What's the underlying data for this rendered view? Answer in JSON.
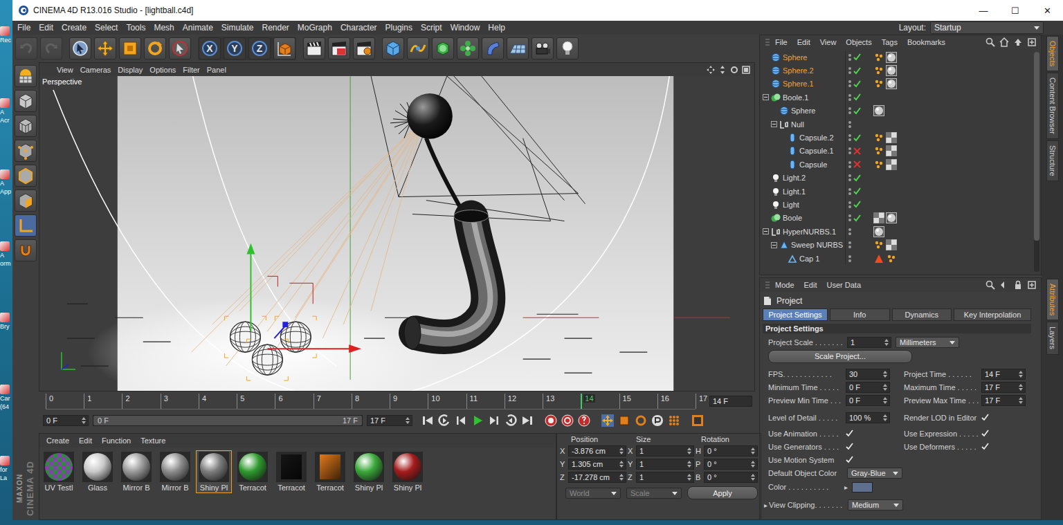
{
  "window": {
    "title": "CINEMA 4D R13.016 Studio - [lightball.c4d]",
    "controls": [
      "—",
      "☐",
      "✕"
    ]
  },
  "desktop_edge": [
    {
      "lines": [
        "Rec"
      ]
    },
    {
      "lines": [
        "A",
        "Acr"
      ]
    },
    {
      "lines": [
        "A",
        "App"
      ]
    },
    {
      "lines": [
        "A",
        "orm"
      ]
    },
    {
      "lines": [
        "Bry"
      ]
    },
    {
      "lines": [
        "Car",
        "(64"
      ]
    },
    {
      "lines": [
        "for",
        "La"
      ]
    }
  ],
  "menu": [
    "File",
    "Edit",
    "Create",
    "Select",
    "Tools",
    "Mesh",
    "Animate",
    "Simulate",
    "Render",
    "MoGraph",
    "Character",
    "Plugins",
    "Script",
    "Window",
    "Help"
  ],
  "layout": {
    "label": "Layout:",
    "value": "Startup"
  },
  "toolbar": {
    "axes": [
      {
        "label": "X",
        "on": true
      },
      {
        "label": "Y",
        "on": true
      },
      {
        "label": "Z",
        "on": true
      }
    ]
  },
  "logo": {
    "brand": "MAXON",
    "product": "CINEMA 4D"
  },
  "viewport": {
    "menu": [
      "View",
      "Cameras",
      "Display",
      "Options",
      "Filter",
      "Panel"
    ],
    "camera": "Perspective"
  },
  "timeline": {
    "ticks": [
      "0",
      "1",
      "2",
      "3",
      "4",
      "5",
      "6",
      "7",
      "8",
      "9",
      "10",
      "11",
      "12",
      "13",
      "14",
      "15",
      "16",
      "17"
    ],
    "current": "14",
    "frame": "14 F"
  },
  "transport": {
    "start": "0 F",
    "slider_left": "0 F",
    "slider_right": "17 F",
    "slider_level": 1,
    "end": "17 F"
  },
  "materials": {
    "menu": [
      "Create",
      "Edit",
      "Function",
      "Texture"
    ],
    "items": [
      {
        "name": "UV Testl",
        "kind": "checker",
        "color": "#8a3fb0",
        "selected": false
      },
      {
        "name": "Glass",
        "kind": "sphere",
        "color": "#c9c9c9",
        "selected": false
      },
      {
        "name": "Mirror B",
        "kind": "sphere",
        "color": "#9a9a9a",
        "selected": false
      },
      {
        "name": "Mirror B",
        "kind": "sphere",
        "color": "#8c8c8c",
        "selected": false
      },
      {
        "name": "Shiny Pl",
        "kind": "sphere",
        "color": "#7d7d7d",
        "selected": true
      },
      {
        "name": "Terracot",
        "kind": "sphere",
        "color": "#2f9a2f",
        "selected": false
      },
      {
        "name": "Terracot",
        "kind": "cube",
        "color": "#151515",
        "selected": false
      },
      {
        "name": "Terracot",
        "kind": "cube",
        "color": "#e07a1c",
        "selected": false
      },
      {
        "name": "Shiny Pl",
        "kind": "sphere",
        "color": "#3aa83a",
        "selected": false
      },
      {
        "name": "Shiny Pl",
        "kind": "sphere",
        "color": "#a51c1c",
        "selected": false
      }
    ]
  },
  "coords": {
    "headers": [
      "Position",
      "Size",
      "Rotation"
    ],
    "rows": [
      {
        "axis": "X",
        "position": "-3.876 cm",
        "size_axis": "X",
        "size": "1",
        "rot_axis": "H",
        "rotation": "0 °"
      },
      {
        "axis": "Y",
        "position": "1.305 cm",
        "size_axis": "Y",
        "size": "1",
        "rot_axis": "P",
        "rotation": "0 °"
      },
      {
        "axis": "Z",
        "position": "-17.278 cm",
        "size_axis": "Z",
        "size": "1",
        "rot_axis": "B",
        "rotation": "0 °"
      }
    ],
    "mode": {
      "value": "World",
      "disabled": true
    },
    "size_mode": {
      "value": "Scale",
      "disabled": true
    },
    "apply": "Apply"
  },
  "objects": {
    "menu": [
      "File",
      "Edit",
      "View",
      "Objects",
      "Tags",
      "Bookmarks"
    ],
    "rows": [
      {
        "name": "Sphere",
        "kind": "sphere",
        "depth": 0,
        "has_children": false,
        "expanded": false,
        "selected": true,
        "activation": "on",
        "tags": [
          "phong",
          "material"
        ]
      },
      {
        "name": "Sphere.2",
        "kind": "sphere",
        "depth": 0,
        "has_children": false,
        "expanded": false,
        "selected": true,
        "activation": "on",
        "tags": [
          "phong",
          "material"
        ]
      },
      {
        "name": "Sphere.1",
        "kind": "sphere",
        "depth": 0,
        "has_children": false,
        "expanded": false,
        "selected": true,
        "activation": "on",
        "tags": [
          "phong",
          "material"
        ]
      },
      {
        "name": "Boole.1",
        "kind": "boole",
        "depth": 0,
        "has_children": true,
        "expanded": true,
        "selected": false,
        "activation": "on",
        "tags": []
      },
      {
        "name": "Sphere",
        "kind": "sphere",
        "depth": 1,
        "has_children": false,
        "expanded": false,
        "selected": false,
        "activation": "on",
        "tags": [
          "material"
        ]
      },
      {
        "name": "Null",
        "kind": "null",
        "depth": 1,
        "has_children": true,
        "expanded": true,
        "selected": false,
        "activation": "none",
        "tags": []
      },
      {
        "name": "Capsule.2",
        "kind": "capsule",
        "depth": 2,
        "has_children": false,
        "expanded": false,
        "selected": false,
        "activation": "on",
        "tags": [
          "phong",
          "checker"
        ]
      },
      {
        "name": "Capsule.1",
        "kind": "capsule",
        "depth": 2,
        "has_children": false,
        "expanded": false,
        "selected": false,
        "activation": "off",
        "tags": [
          "phong",
          "checker"
        ]
      },
      {
        "name": "Capsule",
        "kind": "capsule",
        "depth": 2,
        "has_children": false,
        "expanded": false,
        "selected": false,
        "activation": "off",
        "tags": [
          "phong",
          "checker"
        ]
      },
      {
        "name": "Light.2",
        "kind": "light",
        "depth": 0,
        "has_children": false,
        "expanded": false,
        "selected": false,
        "activation": "on",
        "tags": []
      },
      {
        "name": "Light.1",
        "kind": "light",
        "depth": 0,
        "has_children": false,
        "expanded": false,
        "selected": false,
        "activation": "on",
        "tags": []
      },
      {
        "name": "Light",
        "kind": "light",
        "depth": 0,
        "has_children": false,
        "expanded": false,
        "selected": false,
        "activation": "on",
        "tags": []
      },
      {
        "name": "Boole",
        "kind": "boole",
        "depth": 0,
        "has_children": false,
        "expanded": false,
        "selected": false,
        "activation": "on",
        "tags": [
          "checker",
          "material"
        ]
      },
      {
        "name": "HyperNURBS.1",
        "kind": "nurbs",
        "depth": 0,
        "has_children": true,
        "expanded": true,
        "selected": false,
        "activation": "none",
        "tags": [
          "material"
        ]
      },
      {
        "name": "Sweep NURBS",
        "kind": "sweep",
        "depth": 1,
        "has_children": true,
        "expanded": true,
        "selected": false,
        "activation": "none",
        "tags": [
          "phong",
          "checker"
        ]
      },
      {
        "name": "Cap 1",
        "kind": "cap",
        "depth": 2,
        "has_children": false,
        "expanded": false,
        "selected": false,
        "activation": "none",
        "tags": [
          "triangle",
          "phong"
        ]
      }
    ]
  },
  "attributes": {
    "menu": [
      "Mode",
      "Edit",
      "User Data"
    ],
    "title": "Project",
    "tabs": [
      {
        "label": "Project Settings",
        "selected": true
      },
      {
        "label": "Info",
        "selected": false
      },
      {
        "label": "Dynamics",
        "selected": false
      },
      {
        "label": "Key Interpolation",
        "selected": false
      }
    ],
    "section": "Project Settings",
    "scale": {
      "label": "Project Scale . . . . . . .",
      "value": "1",
      "unit": "Millimeters"
    },
    "scale_button": "Scale Project...",
    "rows": [
      [
        {
          "label": "FPS. . . . . . . . . . . .",
          "kind": "field",
          "value": "30"
        },
        {
          "label": "Project Time . . . . . .",
          "kind": "field",
          "value": "14 F"
        }
      ],
      [
        {
          "label": "Minimum Time . . . . .",
          "kind": "field",
          "value": "0 F"
        },
        {
          "label": "Maximum Time . . . . .",
          "kind": "field",
          "value": "17 F"
        }
      ],
      [
        {
          "label": "Preview Min Time . . .",
          "kind": "field",
          "value": "0 F"
        },
        {
          "label": "Preview Max Time . . .",
          "kind": "field",
          "value": "17 F"
        }
      ],
      [
        {
          "label": "Level of Detail . . . . .",
          "kind": "field",
          "value": "100 %"
        },
        {
          "label": "Render LOD in Editor",
          "kind": "check",
          "checked": true
        }
      ],
      [
        {
          "label": "Use Animation . . . . .",
          "kind": "check",
          "checked": true
        },
        {
          "label": "Use Expression . . . . .",
          "kind": "check",
          "checked": true
        }
      ],
      [
        {
          "label": "Use Generators . . . .",
          "kind": "check",
          "checked": true
        },
        {
          "label": "Use Deformers . . . . .",
          "kind": "check",
          "checked": true
        }
      ],
      [
        {
          "label": "Use Motion System",
          "kind": "check",
          "checked": true
        }
      ]
    ],
    "object_color": {
      "label": "Default Object Color",
      "value": "Gray-Blue"
    },
    "color": {
      "label": "Color . . . . . . . . . .",
      "arrow": "▸",
      "swatch": "#5d6e8e"
    },
    "clipping": {
      "arrow": "▸",
      "label": "View Clipping. . . . . . .",
      "value": "Medium"
    }
  },
  "side_tabs": {
    "top": [
      {
        "label": "Objects",
        "selected": true
      },
      {
        "label": "Content Browser",
        "selected": false
      },
      {
        "label": "Structure",
        "selected": false
      }
    ],
    "bottom": [
      {
        "label": "Attributes",
        "selected": true
      },
      {
        "label": "Layers",
        "selected": false
      }
    ]
  }
}
